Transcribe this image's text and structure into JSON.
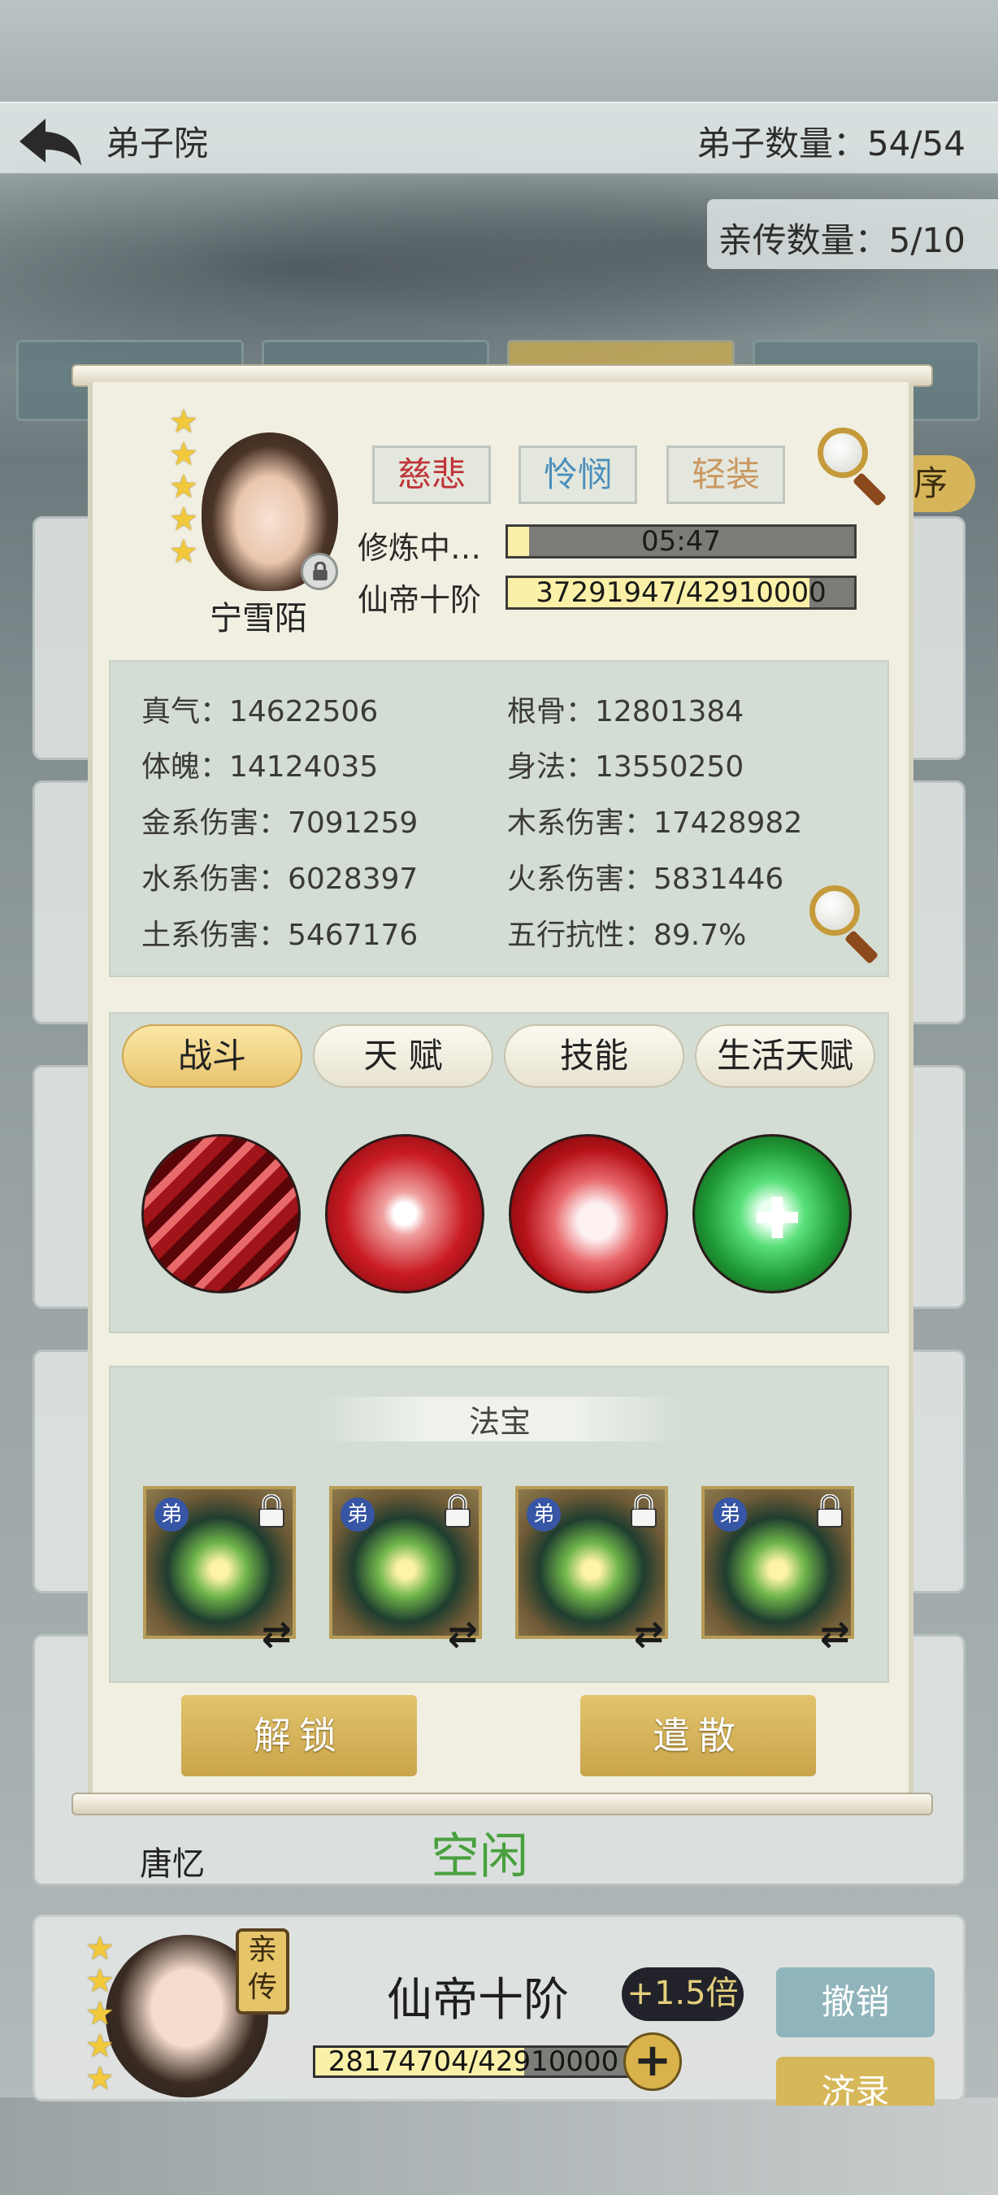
{
  "header": {
    "title": "弟子院",
    "disciple_count": "弟子数量：54/54",
    "direct_count": "亲传数量：5/10"
  },
  "sort_button": "序",
  "disciple": {
    "name": "宁雪陌",
    "stars": 5,
    "traits": [
      "慈悲",
      "怜悯",
      "轻装"
    ],
    "trait_colors": [
      "#c0353a",
      "#4a8fbc",
      "#c99860"
    ],
    "status_label": "修炼中…",
    "status_timer": "05:47",
    "status_progress": 0.06,
    "realm_label": "仙帝十阶",
    "realm_exp": "37291947/42910000",
    "realm_progress": 0.87
  },
  "stats": {
    "zhenqi": "真气：14622506",
    "gengu": "根骨：12801384",
    "tipo": "体魄：14124035",
    "shenfa": "身法：13550250",
    "jin": "金系伤害：7091259",
    "mu": "木系伤害：17428982",
    "shui": "水系伤害：6028397",
    "huo": "火系伤害：5831446",
    "tu": "土系伤害：5467176",
    "wuxing": "五行抗性：89.7%"
  },
  "skill_tabs": [
    "战斗",
    "天 赋",
    "技能",
    "生活天赋"
  ],
  "active_skill_tab": 0,
  "skills": [
    "slash-claw-icon",
    "spear-thrust-icon",
    "crimson-vortex-icon",
    "green-heal-icon"
  ],
  "treasure": {
    "title": "法宝",
    "item_mark": "弟",
    "items": [
      "treasure-orb-icon",
      "treasure-orb-icon",
      "treasure-orb-icon",
      "treasure-orb-icon"
    ]
  },
  "buttons": {
    "unlock": "解锁",
    "dismiss": "遣散"
  },
  "background_list": {
    "prev_name": "唐忆",
    "prev_status": "空闲",
    "next_realm": "仙帝十阶",
    "next_multiplier": "+1.5倍",
    "next_exp": "28174704/42910000",
    "next_badge": "亲传",
    "cancel_label": "撤销",
    "record_label": "济录"
  }
}
